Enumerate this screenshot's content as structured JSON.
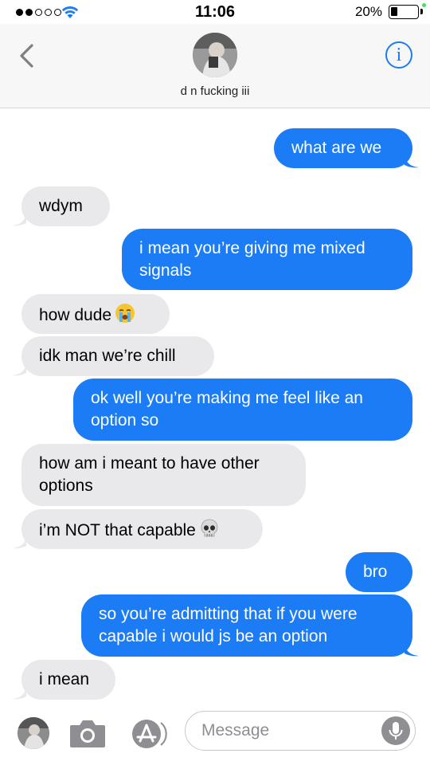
{
  "status_bar": {
    "time": "11:06",
    "battery_percent": "20%",
    "signal_bars_filled": 2,
    "signal_bars_total": 5
  },
  "header": {
    "contact_name": "d n fucking iii",
    "back_icon": "chevron-left-icon",
    "info_icon": "info-icon",
    "info_glyph": "i"
  },
  "conversation": {
    "messages": [
      {
        "direction": "sent",
        "text": "what are we"
      },
      {
        "direction": "received",
        "text": "wdym"
      },
      {
        "direction": "sent",
        "text": "i mean you’re giving me mixed signals"
      },
      {
        "direction": "received",
        "text": "how dude",
        "emoji": "😭"
      },
      {
        "direction": "received",
        "text": "idk man we’re chill"
      },
      {
        "direction": "sent",
        "text": "ok well you’re making me feel like an option so"
      },
      {
        "direction": "received",
        "text": "how am i meant to have other options"
      },
      {
        "direction": "received",
        "text": "i’m NOT that capable",
        "emoji": "💀"
      },
      {
        "direction": "sent",
        "text": "bro"
      },
      {
        "direction": "sent",
        "text": "so you’re admitting that if you were capable i would js be an option"
      },
      {
        "direction": "received",
        "text": "i mean"
      }
    ]
  },
  "composer": {
    "placeholder": "Message",
    "icons": [
      "avatar-icon",
      "camera-icon",
      "app-store-icon",
      "microphone-icon"
    ]
  },
  "colors": {
    "sent_bubble": "#1b7cf5",
    "received_bubble": "#e9e9eb",
    "accent": "#1b7cf5",
    "charging": "#4cd964"
  }
}
